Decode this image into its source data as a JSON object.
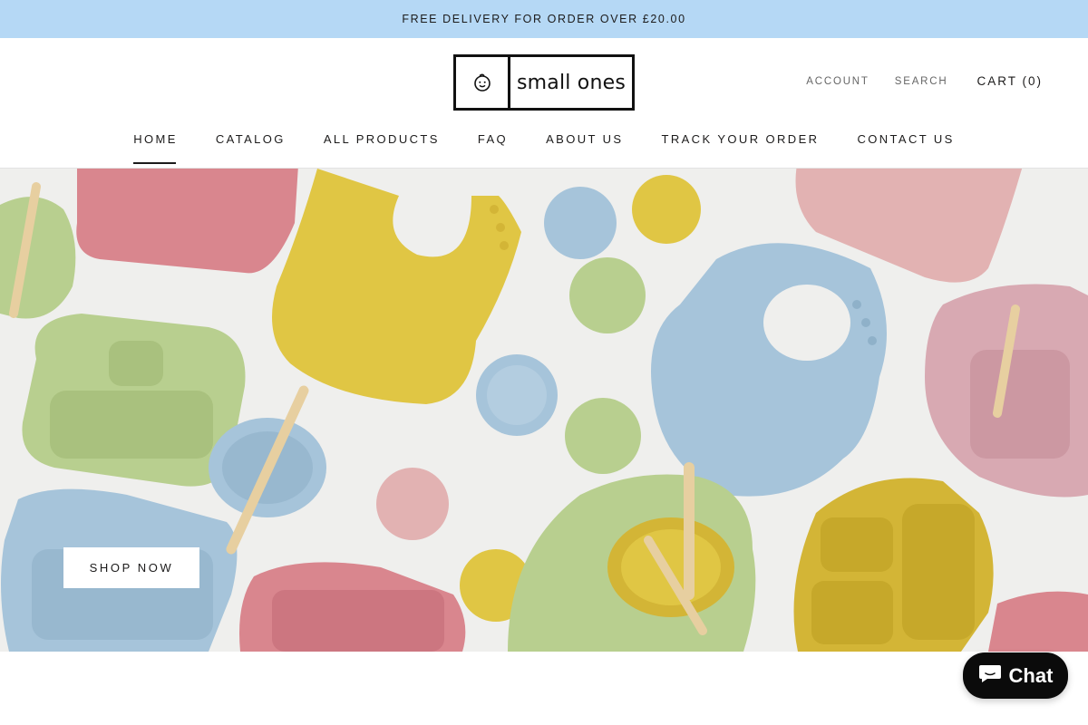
{
  "announcement": {
    "text": "FREE DELIVERY FOR ORDER OVER £20.00"
  },
  "logo": {
    "text": "small ones",
    "icon": "baby-face-icon"
  },
  "header_links": {
    "account": "ACCOUNT",
    "search": "SEARCH",
    "cart": "CART (0)"
  },
  "nav": {
    "items": [
      {
        "label": "HOME",
        "active": true
      },
      {
        "label": "CATALOG"
      },
      {
        "label": "ALL PRODUCTS"
      },
      {
        "label": "FAQ"
      },
      {
        "label": "ABOUT US"
      },
      {
        "label": "TRACK YOUR ORDER"
      },
      {
        "label": "CONTACT US"
      }
    ]
  },
  "hero": {
    "cta": "SHOP NOW",
    "palette": {
      "pink": "#d9868e",
      "blush": "#e2b2b2",
      "yellow": "#e0c644",
      "mustard": "#d3b536",
      "blue": "#a6c4da",
      "sage": "#b8cf8f",
      "mauve": "#d8a9b2",
      "bamboo": "#e7cfa0"
    }
  },
  "chat": {
    "label": "Chat",
    "icon": "chat-bubble-icon"
  }
}
